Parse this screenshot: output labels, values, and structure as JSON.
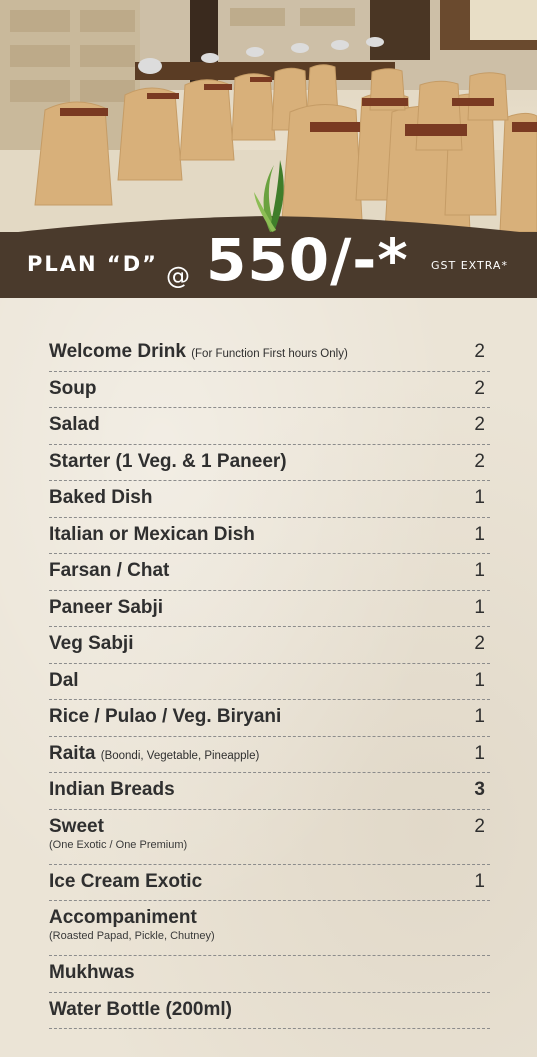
{
  "header": {
    "plan_label": "PLAN “D”",
    "price_prefix": "@",
    "price": "550/-*",
    "tax_note": "GST EXTRA*"
  },
  "menu": {
    "items": [
      {
        "name": "Welcome Drink",
        "note": "(For Function First hours Only)",
        "sub": "",
        "qty": "2"
      },
      {
        "name": "Soup",
        "note": "",
        "sub": "",
        "qty": "2"
      },
      {
        "name": "Salad",
        "note": "",
        "sub": "",
        "qty": "2"
      },
      {
        "name": "Starter  (1 Veg. & 1 Paneer)",
        "note": "",
        "sub": "",
        "qty": "2"
      },
      {
        "name": "Baked Dish",
        "note": "",
        "sub": "",
        "qty": "1"
      },
      {
        "name": "Italian or Mexican Dish",
        "note": "",
        "sub": "",
        "qty": "1"
      },
      {
        "name": "Farsan / Chat",
        "note": "",
        "sub": "",
        "qty": "1"
      },
      {
        "name": "Paneer Sabji",
        "note": "",
        "sub": "",
        "qty": "1"
      },
      {
        "name": "Veg Sabji",
        "note": "",
        "sub": "",
        "qty": "2"
      },
      {
        "name": "Dal",
        "note": "",
        "sub": "",
        "qty": "1"
      },
      {
        "name": "Rice / Pulao / Veg. Biryani",
        "note": "",
        "sub": "",
        "qty": "1"
      },
      {
        "name": "Raita",
        "note": "(Boondi, Vegetable, Pineapple)",
        "sub": "",
        "qty": "1"
      },
      {
        "name": "Indian Breads",
        "note": "",
        "sub": "",
        "qty": "3"
      },
      {
        "name": "Sweet",
        "note": "",
        "sub": "(One Exotic / One Premium)",
        "qty": "2"
      },
      {
        "name": "Ice Cream Exotic",
        "note": "",
        "sub": "",
        "qty": "1"
      },
      {
        "name": "Accompaniment",
        "note": "",
        "sub": "(Roasted Papad, Pickle, Chutney)",
        "qty": ""
      },
      {
        "name": "Mukhwas",
        "note": "",
        "sub": "",
        "qty": ""
      },
      {
        "name": "Water Bottle (200ml)",
        "note": "",
        "sub": "",
        "qty": ""
      }
    ]
  },
  "colors": {
    "banner": "#4a3a2c",
    "paper": "#ebe4d6",
    "text": "#2f2f2f",
    "leaf": "#5f9a3a"
  },
  "icons": [
    "leaf-sprout-icon"
  ]
}
